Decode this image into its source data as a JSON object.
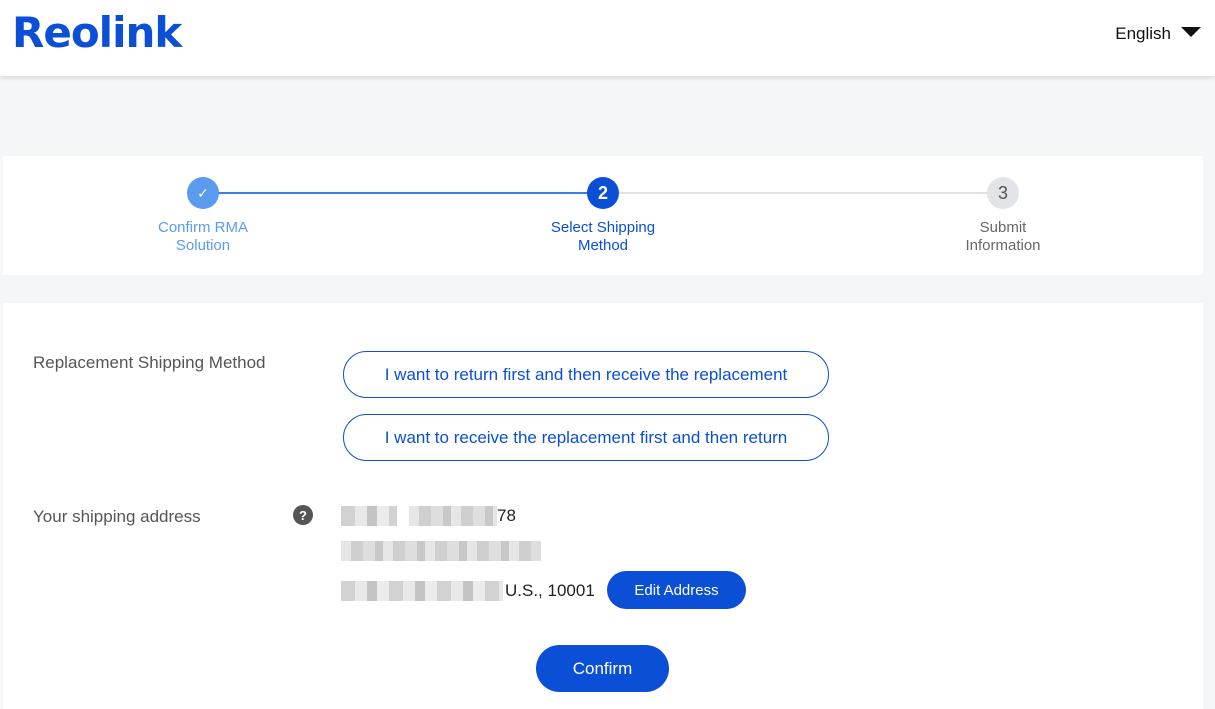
{
  "header": {
    "logo": "Reolink",
    "language": "English"
  },
  "steps": [
    {
      "number": "✓",
      "line1": "Confirm RMA",
      "line2": "Solution",
      "state": "done"
    },
    {
      "number": "2",
      "line1": "Select Shipping",
      "line2": "Method",
      "state": "active"
    },
    {
      "number": "3",
      "line1": "Submit",
      "line2": "Information",
      "state": "todo"
    }
  ],
  "shipping": {
    "method_label": "Replacement Shipping Method",
    "option_1": "I want to return first and then receive the replacement",
    "option_2": "I want to receive the replacement first and then return",
    "address_label": "Your shipping address",
    "help_glyph": "?",
    "address_line1_suffix": "78",
    "address_line3_suffix": "U.S., 10001",
    "edit_label": "Edit Address",
    "confirm_label": "Confirm"
  },
  "colors": {
    "brand": "#0a4fd6",
    "step_done": "#5a9bf0",
    "step_todo": "#e2e4e8"
  }
}
